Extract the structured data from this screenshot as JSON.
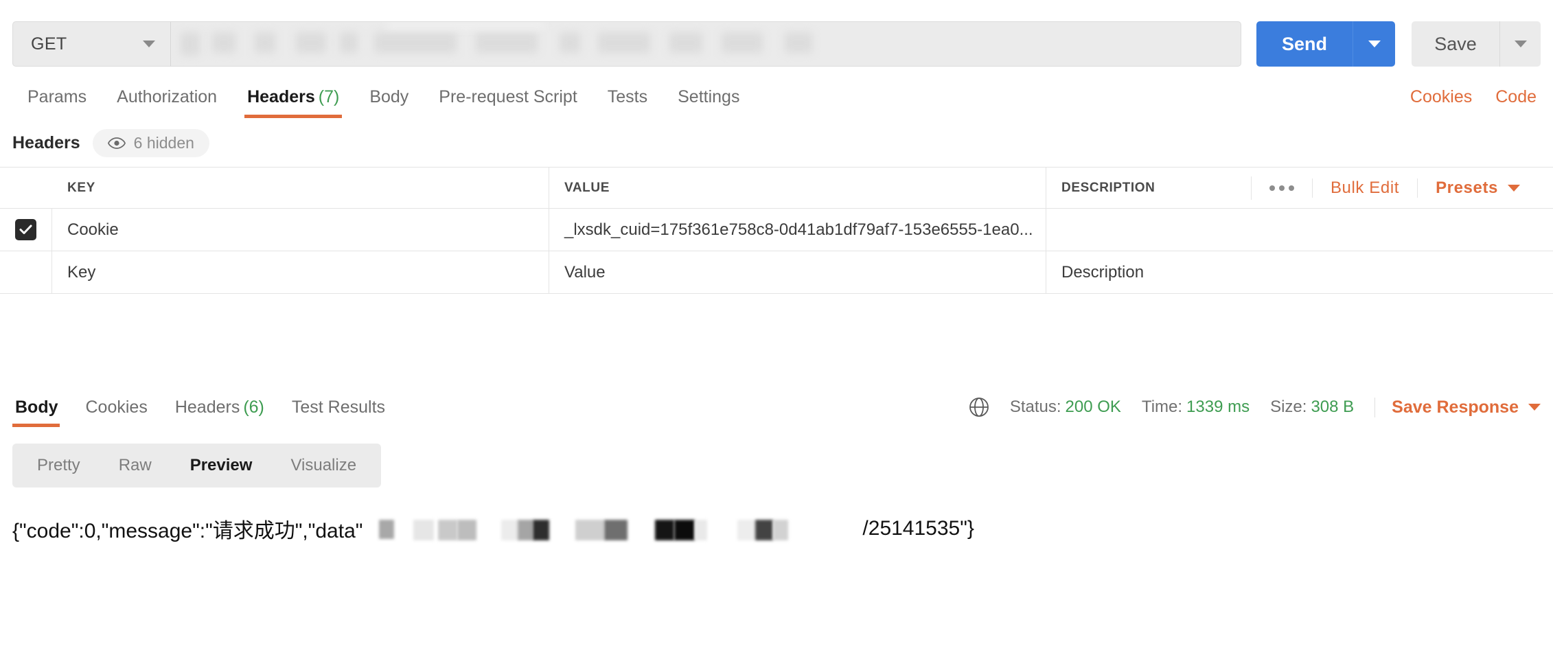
{
  "request_bar": {
    "method": "GET",
    "url_value": "",
    "url_redacted": true,
    "send_label": "Send",
    "send_color": "#3b7ddd",
    "save_label": "Save"
  },
  "request_tabs": {
    "items": [
      {
        "label": "Params",
        "count": "",
        "active": false
      },
      {
        "label": "Authorization",
        "count": "",
        "active": false
      },
      {
        "label": "Headers",
        "count": "(7)",
        "active": true
      },
      {
        "label": "Body",
        "count": "",
        "active": false
      },
      {
        "label": "Pre-request Script",
        "count": "",
        "active": false
      },
      {
        "label": "Tests",
        "count": "",
        "active": false
      },
      {
        "label": "Settings",
        "count": "",
        "active": false
      }
    ],
    "right_links": [
      {
        "label": "Cookies"
      },
      {
        "label": "Code"
      }
    ],
    "active_underline_color": "#e06c3b",
    "count_color": "#3e9c51"
  },
  "headers_section": {
    "title": "Headers",
    "hidden_pill": {
      "icon": "eye-icon",
      "label": "6 hidden"
    },
    "columns": [
      "KEY",
      "VALUE",
      "DESCRIPTION"
    ],
    "actions": {
      "more_label": "•••",
      "bulk_edit_label": "Bulk Edit",
      "presets_label": "Presets"
    },
    "rows": [
      {
        "checked": true,
        "key": "Cookie",
        "value": "_lxsdk_cuid=175f361e758c8-0d41ab1df79af7-153e6555-1ea0...",
        "description": ""
      }
    ],
    "placeholder_row": {
      "key": "Key",
      "value": "Value",
      "description": "Description"
    }
  },
  "response": {
    "tabs": [
      {
        "label": "Body",
        "count": "",
        "active": true
      },
      {
        "label": "Cookies",
        "count": "",
        "active": false
      },
      {
        "label": "Headers",
        "count": "(6)",
        "active": false
      },
      {
        "label": "Test Results",
        "count": "",
        "active": false
      }
    ],
    "meta": {
      "globe_icon": "globe-icon",
      "status_label": "Status:",
      "status_value": "200 OK",
      "time_label": "Time:",
      "time_value": "1339 ms",
      "size_label": "Size:",
      "size_value": "308 B",
      "value_color": "#3e9c51"
    },
    "save_response_label": "Save Response",
    "view_modes": [
      {
        "label": "Pretty",
        "active": false
      },
      {
        "label": "Raw",
        "active": false
      },
      {
        "label": "Preview",
        "active": true
      },
      {
        "label": "Visualize",
        "active": false
      }
    ],
    "body_prefix": "{\"code\":0,\"message\":\"请求成功\",\"data\"",
    "body_suffix": "/25141535\"}",
    "body_redacted": true
  }
}
